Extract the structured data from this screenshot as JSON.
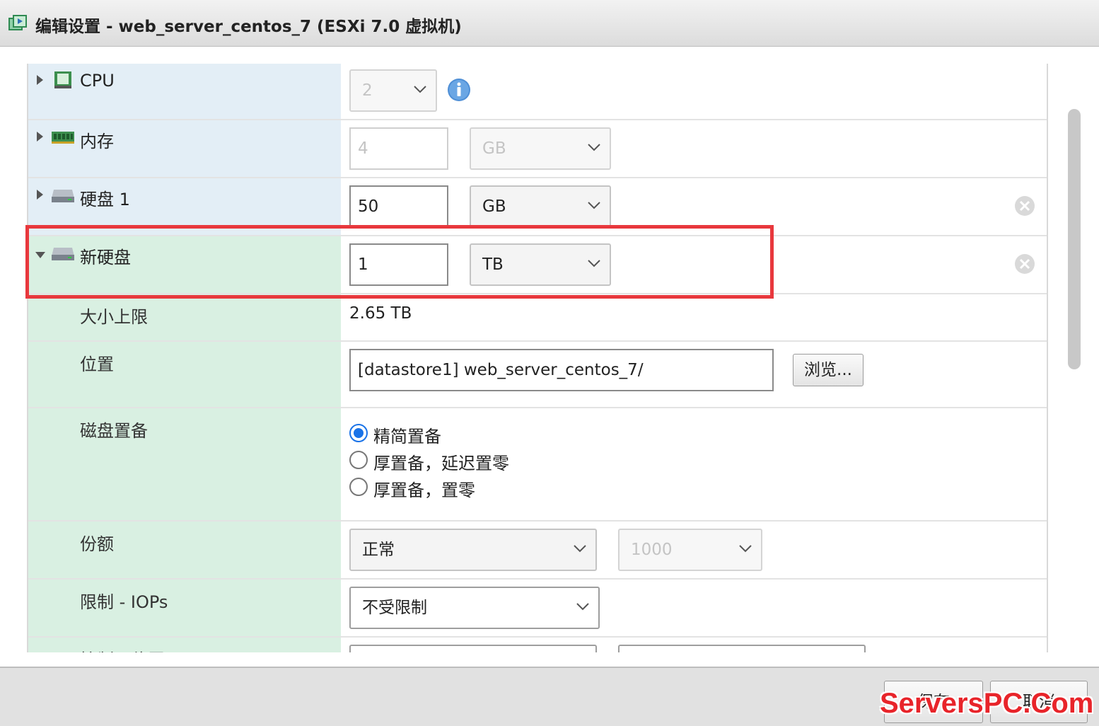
{
  "window": {
    "title": "编辑设置 - web_server_centos_7 (ESXi 7.0 虚拟机)"
  },
  "hardware": {
    "cpu": {
      "label": "CPU",
      "value": "2",
      "icon": "cpu-icon"
    },
    "memory": {
      "label": "内存",
      "value": "4",
      "unit": "GB",
      "icon": "memory-icon"
    },
    "disk1": {
      "label": "硬盘 1",
      "value": "50",
      "unit": "GB",
      "icon": "hard-disk-icon"
    },
    "new_disk": {
      "label": "新硬盘",
      "value": "1",
      "unit": "TB",
      "icon": "hard-disk-icon",
      "max_size_label": "大小上限",
      "max_size_value": "2.65 TB",
      "location_label": "位置",
      "location_value": "[datastore1] web_server_centos_7/",
      "browse_label": "浏览...",
      "provisioning_label": "磁盘置备",
      "provisioning_options": [
        {
          "label": "精简置备",
          "selected": true
        },
        {
          "label": "厚置备，延迟置零",
          "selected": false
        },
        {
          "label": "厚置备，置零",
          "selected": false
        }
      ],
      "shares_label": "份额",
      "shares_value": "正常",
      "shares_number": "1000",
      "limit_label": "限制 - IOPs",
      "limit_value": "不受限制",
      "controller_label": "控制器位置"
    }
  },
  "footer": {
    "save_label": "保存",
    "cancel_label": "取消"
  },
  "watermark": "ServersPC.Com",
  "colors": {
    "highlight": "#e8383d",
    "radio_selected": "#1a73e8",
    "row_blue": "#e3eef6",
    "row_green": "#d9f0e2",
    "watermark": "#e8242a"
  }
}
